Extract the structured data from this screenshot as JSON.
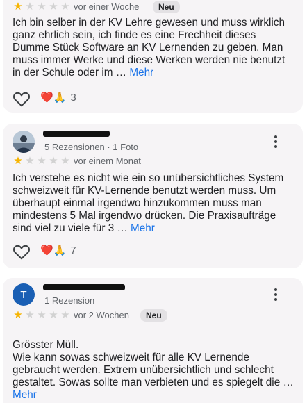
{
  "reviews": [
    {
      "time": "vor einer Woche",
      "badge": "Neu",
      "rating": 1,
      "text": "Ich bin selber in der KV Lehre gewesen und muss wirklich ganz ehrlich sein, ich finde es eine Frechheit dieses Dumme Stück Software an KV Lernenden zu geben. Man muss immer Werke und diese Werken werden nie benutzt in der Schule oder im … ",
      "more": "Mehr",
      "reaction_count": "3"
    },
    {
      "meta": "5 Rezensionen · 1 Foto",
      "time": "vor einem Monat",
      "rating": 1,
      "text": "Ich verstehe es nicht wie ein so unübersichtliches System schweizweit für KV-Lernende benutzt werden muss. Um überhaupt einmal irgendwo hinzukommen muss man mindestens 5 Mal irgendwo drücken. Die Praxisaufträge sind viel zu viele für 3 … ",
      "more": "Mehr",
      "reaction_count": "7"
    },
    {
      "avatar_letter": "T",
      "meta": "1 Rezension",
      "time": "vor 2 Wochen",
      "badge": "Neu",
      "rating": 1,
      "text": "Grösster Müll.\nWie kann sowas schweizweit für alle KV Lernende gebraucht werden. Extrem unübersichtlich und schlecht gestaltet. Sowas sollte man verbieten und es spiegelt die … ",
      "more": "Mehr"
    }
  ],
  "icons": {
    "star": "★",
    "reaction_emojis": "❤️🙏"
  },
  "colors": {
    "star_on": "#f6b400",
    "star_off": "#d2d2d2",
    "link": "#1a73e8",
    "avatar_t": "#1a5fb4"
  }
}
